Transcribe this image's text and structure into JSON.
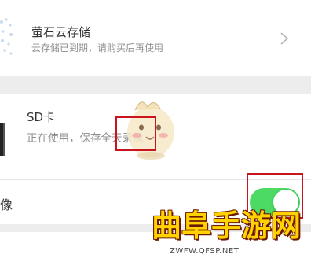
{
  "cloud_storage": {
    "title": "萤石云存储",
    "subtitle": "云存储已到期，请购买后再使用"
  },
  "sd_card": {
    "title": "SD卡",
    "subtitle": "正在使用，保存全天录像"
  },
  "record_row": {
    "label": "像",
    "toggle_on": true
  },
  "watermark": {
    "title": "曲阜手游网",
    "url": "ZWFW.QFSP.NET"
  },
  "colors": {
    "toggle_on": "#4cd964",
    "highlight_box": "#c9151e",
    "watermark_gold": "#ffd200"
  }
}
